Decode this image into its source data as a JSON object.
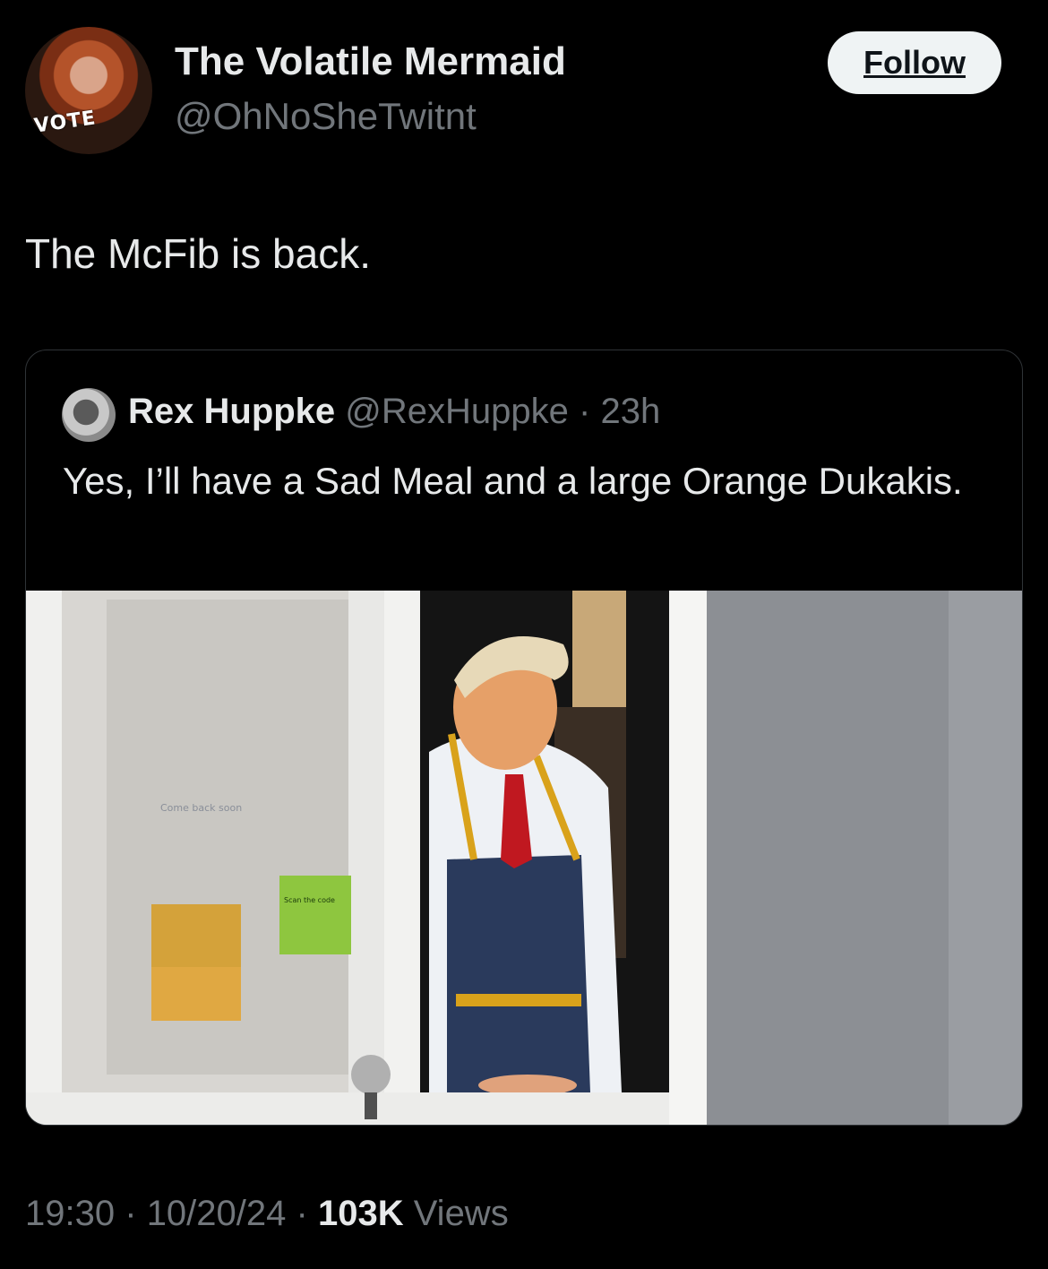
{
  "author": {
    "display_name": "The Volatile Mermaid",
    "handle": "@OhNoSheTwitnt",
    "avatar_badge_text": "VOTE"
  },
  "follow_label": "Follow",
  "tweet": {
    "text": "The McFib is back."
  },
  "quoted": {
    "display_name": "Rex Huppke",
    "handle": "@RexHuppke",
    "separator": "·",
    "age": "23h",
    "text": "Yes, I’ll have a Sad Meal and a large Orange Dukakis.",
    "image_signs": {
      "window_sign": "Come back soon",
      "scan_sticker": "Scan the code"
    }
  },
  "meta": {
    "time": "19:30",
    "date": "10/20/24",
    "views_count": "103K",
    "views_label": "Views",
    "separator": "·"
  },
  "colors": {
    "background": "#000000",
    "text_primary": "#e7e9ea",
    "text_secondary": "#71767b",
    "border": "#2f3336",
    "follow_bg": "#eff3f4",
    "apron": "#2a3a5c",
    "apron_strap": "#d9a21b",
    "tie": "#c01820"
  }
}
